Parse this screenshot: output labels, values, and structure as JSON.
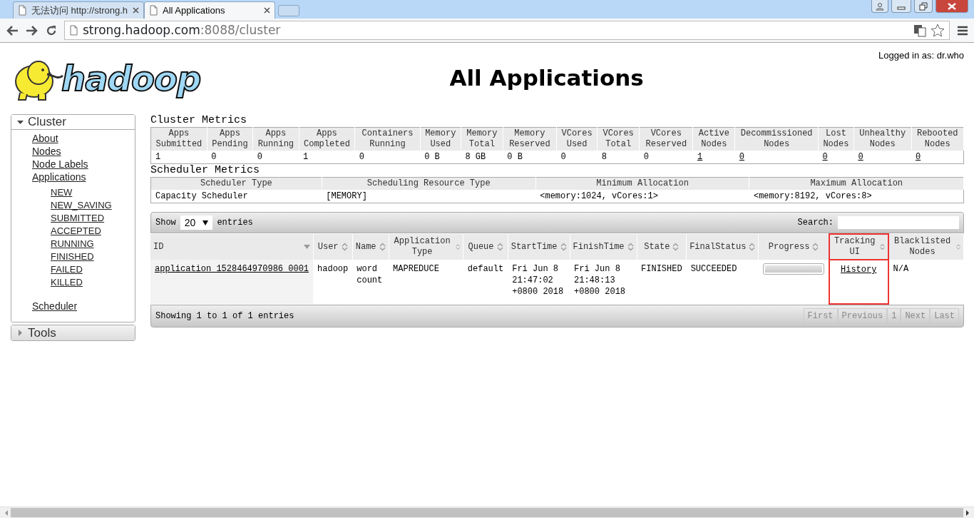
{
  "browser": {
    "tabs": [
      {
        "title": "无法访问 http://strong.h",
        "selected": false
      },
      {
        "title": "All Applications",
        "selected": true
      }
    ],
    "address": {
      "host": "strong.hadoop.com",
      "rest": ":8088/cluster"
    }
  },
  "header": {
    "logo_text": "hadoop",
    "title": "All Applications",
    "logged_in": "Logged in as: dr.who"
  },
  "sidebar": [
    {
      "label": "Cluster",
      "expanded": true,
      "items": [
        {
          "label": "About"
        },
        {
          "label": "Nodes"
        },
        {
          "label": "Node Labels"
        },
        {
          "label": "Applications",
          "children": [
            {
              "label": "NEW"
            },
            {
              "label": "NEW_SAVING"
            },
            {
              "label": "SUBMITTED"
            },
            {
              "label": "ACCEPTED"
            },
            {
              "label": "RUNNING"
            },
            {
              "label": "FINISHED"
            },
            {
              "label": "FAILED"
            },
            {
              "label": "KILLED"
            }
          ]
        },
        {
          "label": "Scheduler"
        }
      ]
    },
    {
      "label": "Tools",
      "expanded": false
    }
  ],
  "cluster_metrics": {
    "title": "Cluster Metrics",
    "columns": [
      "Apps Submitted",
      "Apps Pending",
      "Apps Running",
      "Apps Completed",
      "Containers Running",
      "Memory Used",
      "Memory Total",
      "Memory Reserved",
      "VCores Used",
      "VCores Total",
      "VCores Reserved",
      "Active Nodes",
      "Decommissioned Nodes",
      "Lost Nodes",
      "Unhealthy Nodes",
      "Rebooted Nodes"
    ],
    "row": [
      {
        "text": "1",
        "link": false
      },
      {
        "text": "0",
        "link": false
      },
      {
        "text": "0",
        "link": false
      },
      {
        "text": "1",
        "link": false
      },
      {
        "text": "0",
        "link": false
      },
      {
        "text": "0 B",
        "link": false
      },
      {
        "text": "8 GB",
        "link": false
      },
      {
        "text": "0 B",
        "link": false
      },
      {
        "text": "0",
        "link": false
      },
      {
        "text": "8",
        "link": false
      },
      {
        "text": "0",
        "link": false
      },
      {
        "text": "1",
        "link": true
      },
      {
        "text": "0",
        "link": true
      },
      {
        "text": "0",
        "link": true
      },
      {
        "text": "0",
        "link": true
      },
      {
        "text": "0",
        "link": true
      }
    ]
  },
  "scheduler_metrics": {
    "title": "Scheduler Metrics",
    "columns": [
      "Scheduler Type",
      "Scheduling Resource Type",
      "Minimum Allocation",
      "Maximum Allocation"
    ],
    "row": [
      "Capacity Scheduler",
      "[MEMORY]",
      "<memory:1024, vCores:1>",
      "<memory:8192, vCores:8>"
    ]
  },
  "apps": {
    "show_label": "Show",
    "length": "20",
    "entries_label": "entries",
    "search_label": "Search:",
    "columns": [
      {
        "label": "ID",
        "sorted": true,
        "highlighted": false
      },
      {
        "label": "User",
        "sorted": false,
        "highlighted": false
      },
      {
        "label": "Name",
        "sorted": false,
        "highlighted": false
      },
      {
        "label": "Application Type",
        "sorted": false,
        "highlighted": false
      },
      {
        "label": "Queue",
        "sorted": false,
        "highlighted": false
      },
      {
        "label": "StartTime",
        "sorted": false,
        "highlighted": false
      },
      {
        "label": "FinishTime",
        "sorted": false,
        "highlighted": false
      },
      {
        "label": "State",
        "sorted": false,
        "highlighted": false
      },
      {
        "label": "FinalStatus",
        "sorted": false,
        "highlighted": false
      },
      {
        "label": "Progress",
        "sorted": false,
        "highlighted": false
      },
      {
        "label": "Tracking UI",
        "sorted": false,
        "highlighted": true
      },
      {
        "label": "Blacklisted Nodes",
        "sorted": false,
        "highlighted": false
      }
    ],
    "rows": [
      {
        "id": "application_1528464970986_0001",
        "user": "hadoop",
        "name": "word count",
        "type": "MAPREDUCE",
        "queue": "default",
        "start": "Fri Jun 8 21:47:02 +0800 2018",
        "finish": "Fri Jun 8 21:48:13 +0800 2018",
        "state": "FINISHED",
        "final_status": "SUCCEEDED",
        "level": 1,
        "tracking": "History",
        "blacklisted": "N/A"
      }
    ],
    "info": "Showing 1 to 1 of 1 entries",
    "pages": [
      {
        "label": "First",
        "disabled": true
      },
      {
        "label": "Previous",
        "disabled": true
      },
      {
        "label": "1",
        "disabled": true
      },
      {
        "label": "Next",
        "disabled": true
      },
      {
        "label": "Last",
        "disabled": true
      }
    ]
  }
}
